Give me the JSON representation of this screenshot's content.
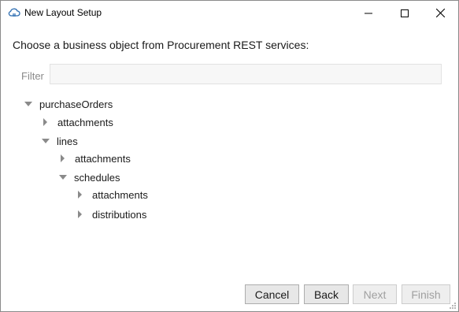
{
  "window": {
    "title": "New Layout Setup",
    "app_icon": "cloud-icon",
    "controls": [
      "minimize-icon",
      "maximize-icon",
      "close-icon"
    ]
  },
  "prompt": "Choose a business object from Procurement REST services:",
  "filter": {
    "label": "Filter",
    "value": "",
    "placeholder": ""
  },
  "tree": [
    {
      "label": "purchaseOrders",
      "state": "expanded",
      "level": 0
    },
    {
      "label": "attachments",
      "state": "collapsed",
      "level": 1
    },
    {
      "label": "lines",
      "state": "expanded",
      "level": 1
    },
    {
      "label": "attachments",
      "state": "collapsed",
      "level": 2
    },
    {
      "label": "schedules",
      "state": "expanded",
      "level": 2
    },
    {
      "label": "attachments",
      "state": "collapsed",
      "level": 3
    },
    {
      "label": "distributions",
      "state": "collapsed",
      "level": 3
    }
  ],
  "buttons": {
    "cancel": "Cancel",
    "back": "Back",
    "next": "Next",
    "finish": "Finish"
  },
  "button_states": {
    "next_enabled": false,
    "finish_enabled": false
  }
}
